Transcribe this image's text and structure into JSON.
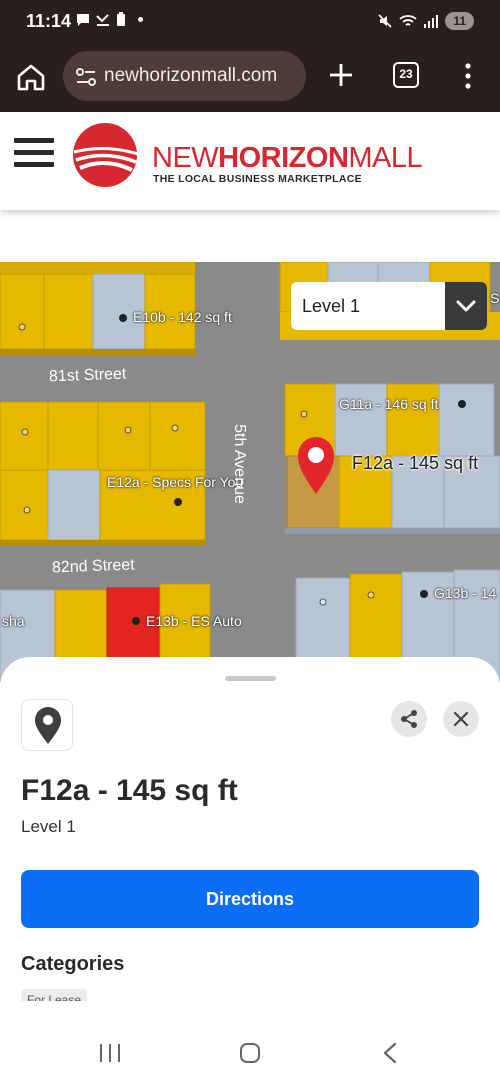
{
  "status_bar": {
    "time": "11:14",
    "battery": "11"
  },
  "browser": {
    "url": "newhorizonmall.com",
    "tab_count": "23"
  },
  "site": {
    "logo_name_part1": "NEW",
    "logo_name_part2": "HORIZON",
    "logo_name_part3": "MALL",
    "tagline": "THE LOCAL BUSINESS MARKETPLACE"
  },
  "map": {
    "level": "Level 1",
    "streets": {
      "s81": "81st Street",
      "s82": "82nd Street",
      "ave5": "5th Avenue"
    },
    "units": {
      "e10b": "E10b - 142 sq ft",
      "g11a": "G11a - 146 sq ft",
      "f12a": "F12a - 145 sq ft",
      "e12a": "E12a - Specs For You",
      "e13b": "E13b - ES Auto",
      "g13b": "G13b - 14",
      "left_sha": "sha",
      "right_s": "S"
    }
  },
  "sheet": {
    "title": "F12a - 145 sq ft",
    "subtitle": "Level 1",
    "directions_label": "Directions",
    "categories_label": "Categories",
    "chip_label": "For Lease"
  },
  "colors": {
    "accent": "#0b6df3",
    "brand_red": "#d7282f",
    "unit_yellow": "#e6b800",
    "unit_blue": "#b7c4d4",
    "selected_red": "#e5251f"
  }
}
